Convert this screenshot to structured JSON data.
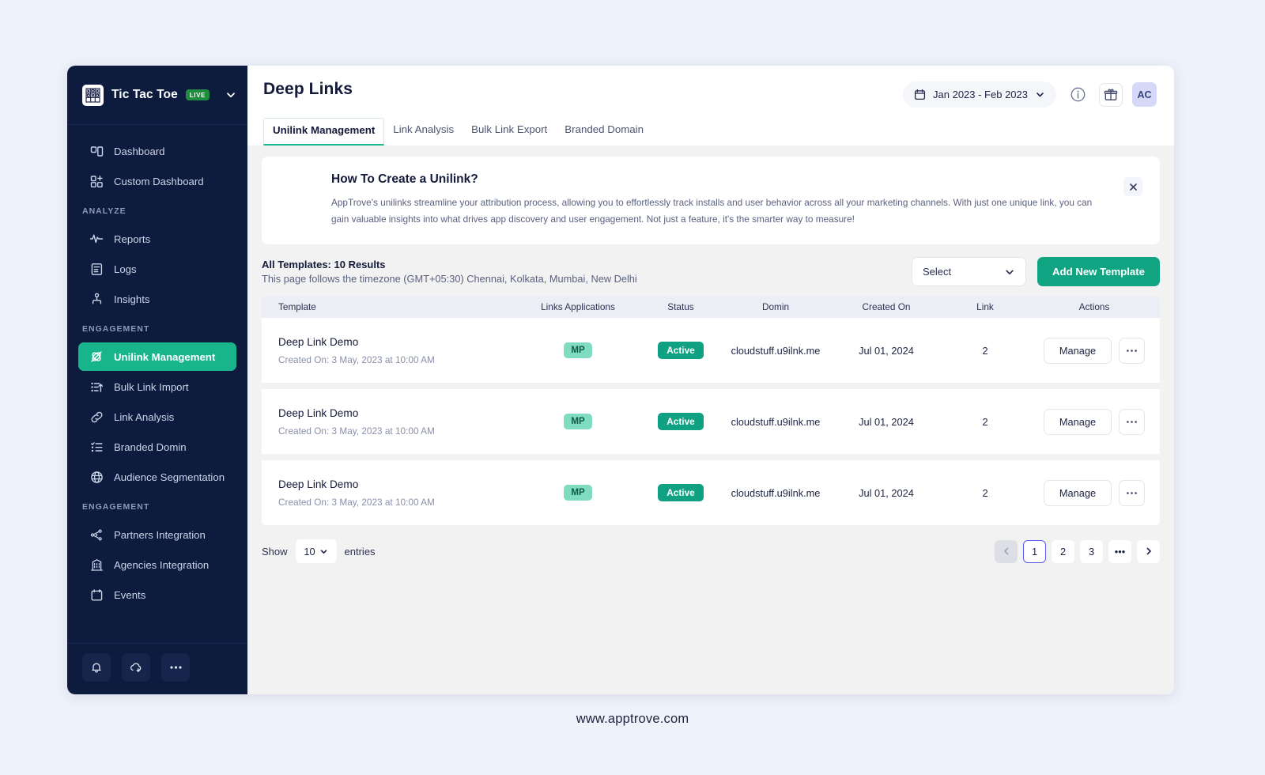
{
  "sidebar": {
    "brand": {
      "name": "Tic Tac Toe",
      "badge": "LIVE",
      "logo_icon": "tic-tac-toe-logo",
      "caret_icon": "chevron-down-icon"
    },
    "groups": [
      {
        "label": "",
        "items": [
          {
            "label": "Dashboard",
            "icon": "dashboard-icon",
            "active": false
          },
          {
            "label": "Custom Dashboard",
            "icon": "custom-dashboard-icon",
            "active": false
          }
        ]
      },
      {
        "label": "ANALYZE",
        "items": [
          {
            "label": "Reports",
            "icon": "pulse-icon",
            "active": false
          },
          {
            "label": "Logs",
            "icon": "logs-icon",
            "active": false
          },
          {
            "label": "Insights",
            "icon": "insights-icon",
            "active": false
          }
        ]
      },
      {
        "label": "ENGAGEMENT",
        "items": [
          {
            "label": "Unilink Management",
            "icon": "unilink-icon",
            "active": true
          },
          {
            "label": "Bulk Link Import",
            "icon": "bulk-import-icon",
            "active": false
          },
          {
            "label": "Link Analysis",
            "icon": "link-icon",
            "active": false
          },
          {
            "label": "Branded Domin",
            "icon": "checklist-icon",
            "active": false
          },
          {
            "label": "Audience Segmentation",
            "icon": "globe-icon",
            "active": false
          }
        ]
      },
      {
        "label": "ENGAGEMENT",
        "items": [
          {
            "label": "Partners Integration",
            "icon": "partners-icon",
            "active": false
          },
          {
            "label": "Agencies Integration",
            "icon": "agencies-icon",
            "active": false
          },
          {
            "label": "Events",
            "icon": "events-calendar-icon",
            "active": false
          }
        ]
      }
    ],
    "footer_buttons": [
      {
        "icon": "bell-icon"
      },
      {
        "icon": "cloud-download-icon"
      },
      {
        "icon": "more-horizontal-icon"
      }
    ]
  },
  "header": {
    "title": "Deep Links",
    "date_range": "Jan 2023 - Feb 2023",
    "calendar_icon": "calendar-icon",
    "caret_icon": "chevron-down-icon",
    "info_icon": "info-circle-icon",
    "gift_icon": "gift-icon",
    "avatar_initials": "AC",
    "tabs": [
      {
        "label": "Unilink Management",
        "active": true
      },
      {
        "label": "Link Analysis",
        "active": false
      },
      {
        "label": "Bulk Link Export",
        "active": false
      },
      {
        "label": "Branded Domain",
        "active": false
      }
    ]
  },
  "banner": {
    "title": "How To Create a Unilink?",
    "body": "AppTrove's unilinks streamline your attribution process, allowing you to effortlessly track installs and user behavior across all your marketing channels. With just one unique link, you can gain valuable insights into what drives app discovery and user engagement. Not just a feature, it's the smarter way to measure!",
    "close_icon": "close-icon"
  },
  "results": {
    "title": "All Templates: 10 Results",
    "subtitle": "This page follows the timezone (GMT+05:30) Chennai, Kolkata, Mumbai, New Delhi",
    "select_label": "Select",
    "select_caret_icon": "chevron-down-icon",
    "add_button": "Add New Template"
  },
  "table": {
    "columns": [
      "Template",
      "Links Applications",
      "Status",
      "Domin",
      "Created On",
      "Link",
      "Actions"
    ],
    "rows": [
      {
        "template": "Deep Link Demo",
        "created_sub": "Created On: 3 May, 2023 at 10:00 AM",
        "apps": "MP",
        "status": "Active",
        "domain": "cloudstuff.u9ilnk.me",
        "created_on": "Jul 01, 2024",
        "link": "2",
        "manage_label": "Manage",
        "more_icon": "more-horizontal-icon"
      },
      {
        "template": "Deep Link Demo",
        "created_sub": "Created On: 3 May, 2023 at 10:00 AM",
        "apps": "MP",
        "status": "Active",
        "domain": "cloudstuff.u9ilnk.me",
        "created_on": "Jul 01, 2024",
        "link": "2",
        "manage_label": "Manage",
        "more_icon": "more-horizontal-icon"
      },
      {
        "template": "Deep Link Demo",
        "created_sub": "Created On: 3 May, 2023 at 10:00 AM",
        "apps": "MP",
        "status": "Active",
        "domain": "cloudstuff.u9ilnk.me",
        "created_on": "Jul 01, 2024",
        "link": "2",
        "manage_label": "Manage",
        "more_icon": "more-horizontal-icon"
      }
    ]
  },
  "pagination": {
    "show_label": "Show",
    "entries_value": "10",
    "entries_label": "entries",
    "prev_icon": "chevron-left-icon",
    "next_icon": "chevron-right-icon",
    "pages": [
      "1",
      "2",
      "3",
      "•••"
    ],
    "current_page": "1"
  },
  "footer": {
    "url": "www.apptrove.com"
  },
  "colors": {
    "sidebar_bg": "#0d1b3e",
    "accent_teal": "#18b58c",
    "primary_button": "#11a483",
    "status_active": "#10a183",
    "chip_mp": "#7fdcc0",
    "page_bg": "#eef2fb",
    "current_page_border": "#5b5bf0"
  }
}
